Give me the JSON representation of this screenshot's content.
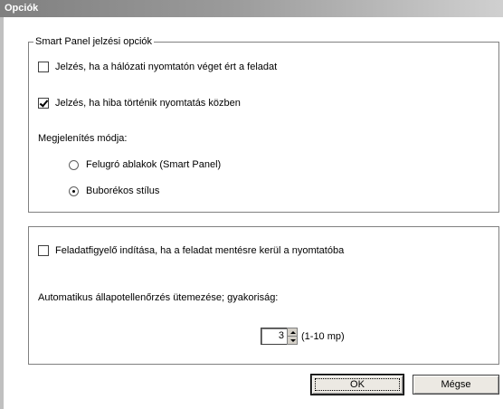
{
  "window": {
    "title": "Opciók"
  },
  "notify_group": {
    "legend": "Smart Panel jelzési opciók",
    "options": [
      {
        "label": "Jelzés, ha a hálózati nyomtatón véget ért a feladat",
        "checked": false
      },
      {
        "label": "Jelzés, ha hiba történik nyomtatás közben",
        "checked": true
      }
    ],
    "display_mode_label": "Megjelenítés módja:",
    "display_modes": [
      {
        "label": "Felugró ablakok (Smart Panel)",
        "selected": false
      },
      {
        "label": "Buborékos stílus",
        "selected": true
      }
    ]
  },
  "job_group": {
    "job_monitor_label": "Feladatfigyelő indítása, ha a feladat mentésre kerül a nyomtatóba",
    "job_monitor_checked": false,
    "schedule_label": "Automatikus állapotellenőrzés ütemezése; gyakoriság:",
    "interval_value": "3",
    "interval_range": "(1-10 mp)"
  },
  "buttons": {
    "ok": "OK",
    "cancel": "Mégse"
  }
}
